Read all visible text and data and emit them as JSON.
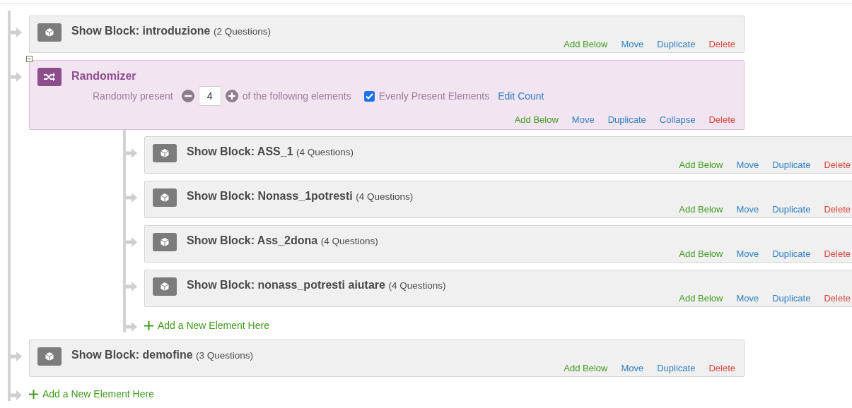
{
  "flow": [
    {
      "kind": "block",
      "title": "Show Block: introduzione",
      "count": "(2 Questions)",
      "actions": [
        {
          "kind": "add",
          "label": "Add Below"
        },
        {
          "kind": "move",
          "label": "Move"
        },
        {
          "kind": "duplicate",
          "label": "Duplicate"
        },
        {
          "kind": "delete",
          "label": "Delete"
        }
      ]
    },
    {
      "kind": "randomizer",
      "title": "Randomizer",
      "expanded": true,
      "prefix": "Randomly present",
      "value": "4",
      "suffix": "of the following elements",
      "evenly": {
        "label": "Evenly Present Elements",
        "checked": true
      },
      "edit_count": "Edit Count",
      "actions": [
        {
          "kind": "add",
          "label": "Add Below"
        },
        {
          "kind": "move",
          "label": "Move"
        },
        {
          "kind": "duplicate",
          "label": "Duplicate"
        },
        {
          "kind": "collapse",
          "label": "Collapse"
        },
        {
          "kind": "delete",
          "label": "Delete"
        }
      ],
      "children": [
        {
          "kind": "block",
          "title": "Show Block: ASS_1",
          "count": "(4 Questions)",
          "actions": [
            {
              "kind": "add",
              "label": "Add Below"
            },
            {
              "kind": "move",
              "label": "Move"
            },
            {
              "kind": "duplicate",
              "label": "Duplicate"
            },
            {
              "kind": "delete",
              "label": "Delete"
            }
          ]
        },
        {
          "kind": "block",
          "title": "Show Block: Nonass_1potresti",
          "count": "(4 Questions)",
          "actions": [
            {
              "kind": "add",
              "label": "Add Below"
            },
            {
              "kind": "move",
              "label": "Move"
            },
            {
              "kind": "duplicate",
              "label": "Duplicate"
            },
            {
              "kind": "delete",
              "label": "Delete"
            }
          ]
        },
        {
          "kind": "block",
          "title": "Show Block: Ass_2dona",
          "count": "(4 Questions)",
          "actions": [
            {
              "kind": "add",
              "label": "Add Below"
            },
            {
              "kind": "move",
              "label": "Move"
            },
            {
              "kind": "duplicate",
              "label": "Duplicate"
            },
            {
              "kind": "delete",
              "label": "Delete"
            }
          ]
        },
        {
          "kind": "block",
          "title": "Show Block: nonass_potresti aiutare",
          "count": "(4 Questions)",
          "actions": [
            {
              "kind": "add",
              "label": "Add Below"
            },
            {
              "kind": "move",
              "label": "Move"
            },
            {
              "kind": "duplicate",
              "label": "Duplicate"
            },
            {
              "kind": "delete",
              "label": "Delete"
            }
          ]
        }
      ],
      "add_element": "Add a New Element Here"
    },
    {
      "kind": "block",
      "title": "Show Block: demofine",
      "count": "(3 Questions)",
      "actions": [
        {
          "kind": "add",
          "label": "Add Below"
        },
        {
          "kind": "move",
          "label": "Move"
        },
        {
          "kind": "duplicate",
          "label": "Duplicate"
        },
        {
          "kind": "delete",
          "label": "Delete"
        }
      ]
    }
  ],
  "add_element": "Add a New Element Here"
}
